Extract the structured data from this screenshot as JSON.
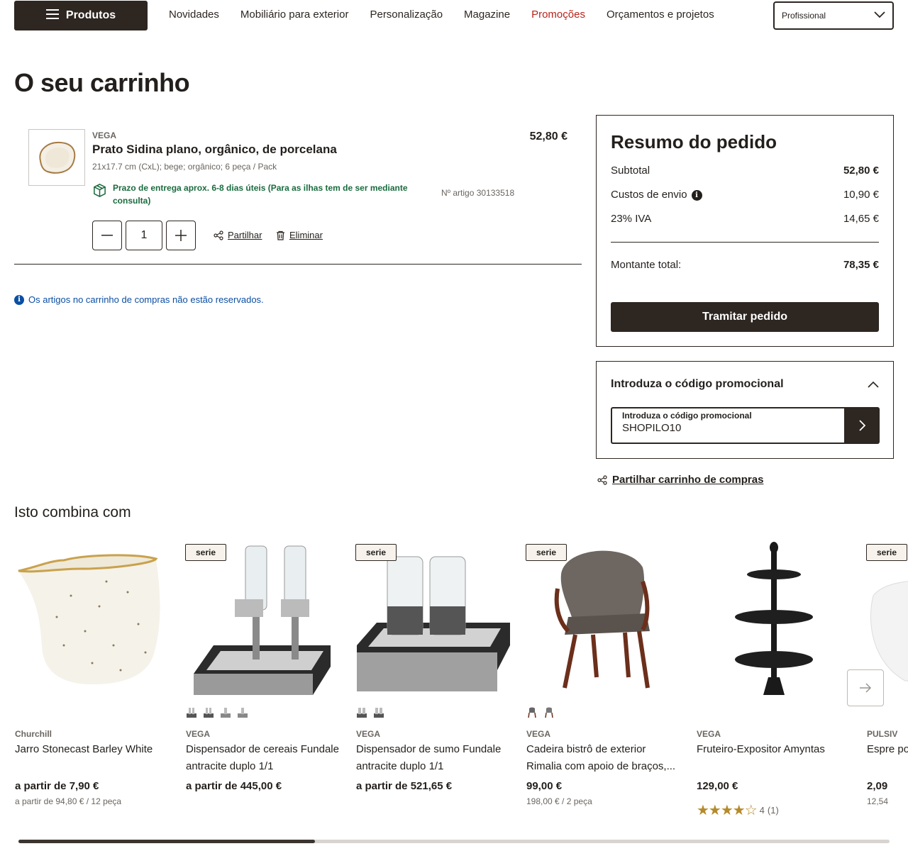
{
  "header": {
    "menu_label": "Produtos",
    "nav": [
      "Novidades",
      "Mobiliário para exterior",
      "Personalização",
      "Magazine",
      "Promoções",
      "Orçamentos e projetos"
    ],
    "customer_type": "Profissional"
  },
  "page_title": "O seu carrinho",
  "cart_item": {
    "brand": "VEGA",
    "name": "Prato Sidina plano, orgânico, de porcelana",
    "description": "21x17.7 cm (CxL); bege; orgânico; 6 peça / Pack",
    "delivery": "Prazo de entrega aprox. 6-8 dias úteis (Para as ilhas tem de ser mediante consulta)",
    "article_no": "Nº artigo 30133518",
    "price": "52,80 €",
    "quantity": "1",
    "share_label": "Partilhar",
    "delete_label": "Eliminar"
  },
  "notice": "Os artigos no carrinho de compras não estão reservados.",
  "summary": {
    "title": "Resumo do pedido",
    "subtotal_label": "Subtotal",
    "subtotal": "52,80 €",
    "shipping_label": "Custos de envio",
    "shipping": "10,90 €",
    "vat_label": "23% IVA",
    "vat": "14,65 €",
    "total_label": "Montante total:",
    "total": "78,35 €",
    "checkout_label": "Tramitar pedido"
  },
  "promo": {
    "title": "Introduza o código promocional",
    "field_label": "Introduza o código promocional",
    "value": "SHOPILO10"
  },
  "share_cart_label": "Partilhar carrinho de compras",
  "recommendations": {
    "title": "Isto combina com",
    "items": [
      {
        "brand": "Churchill",
        "name": "Jarro Stonecast Barley White",
        "price": "a partir de 7,90 €",
        "unit": "a partir de 94,80 € / 12 peça",
        "badge": ""
      },
      {
        "brand": "VEGA",
        "name": "Dispensador de cereais Fundale antracite duplo 1/1",
        "price": "a partir de 445,00 €",
        "unit": "",
        "badge": "serie"
      },
      {
        "brand": "VEGA",
        "name": "Dispensador de sumo Fundale antracite duplo 1/1",
        "price": "a partir de 521,65 €",
        "unit": "",
        "badge": "serie"
      },
      {
        "brand": "VEGA",
        "name": "Cadeira bistrô de exterior Rimalia com apoio de braços,...",
        "price": "99,00 €",
        "unit": "198,00 € / 2 peça",
        "badge": "serie"
      },
      {
        "brand": "VEGA",
        "name": "Fruteiro-Expositor Amyntas",
        "price": "129,00 €",
        "unit": "",
        "badge": "",
        "rating": 4,
        "rating_text": "4",
        "reviews": "(1)"
      },
      {
        "brand": "PULSIV",
        "name": "Espre porce",
        "price": "2,09",
        "unit": "12,54",
        "badge": "serie"
      }
    ]
  },
  "colors": {
    "dark": "#2d2621",
    "promo_red": "#b8241c",
    "delivery_green": "#1a6b3e",
    "info_blue": "#0b4fa3",
    "star_gold": "#b58a2a"
  }
}
